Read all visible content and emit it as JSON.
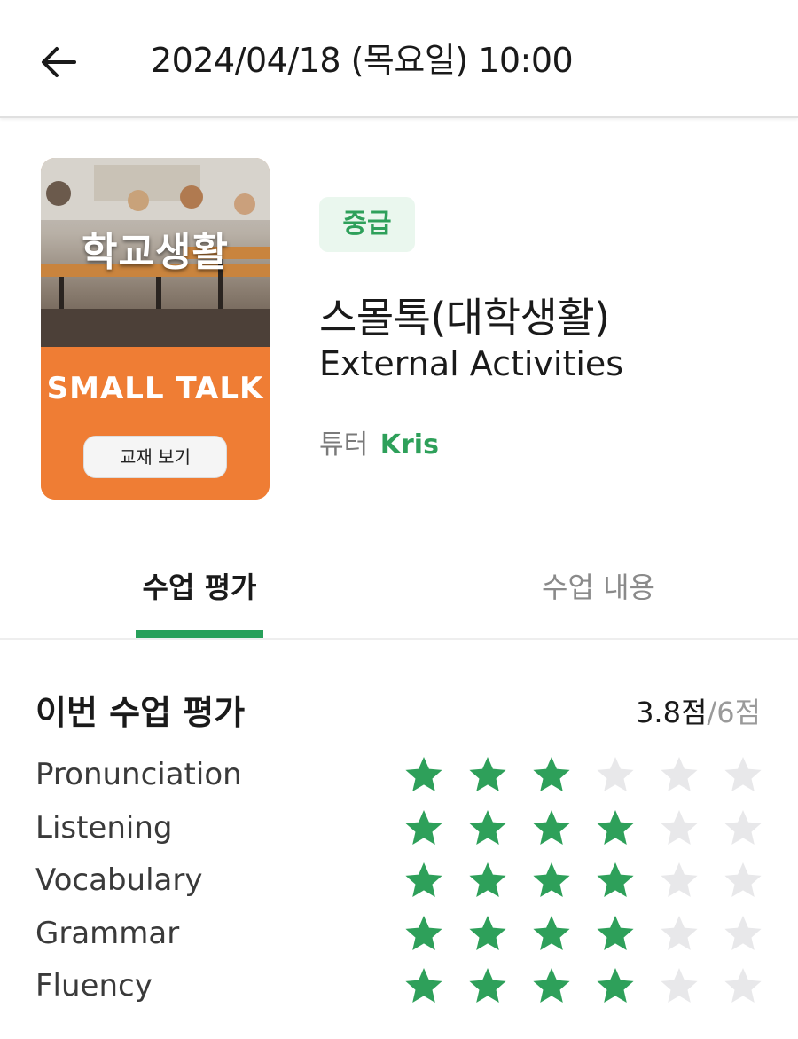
{
  "header": {
    "title": "2024/04/18 (목요일) 10:00",
    "back_icon": "arrow-left-icon"
  },
  "lesson": {
    "thumbnail": {
      "title": "학교생활",
      "subtitle": "SMALL TALK",
      "material_button": "교재 보기"
    },
    "level": "중급",
    "title_ko": "스몰톡(대학생활)",
    "title_en": "External Activities",
    "tutor_label": "튜터",
    "tutor_name": "Kris"
  },
  "tabs": [
    {
      "label": "수업 평가",
      "active": true
    },
    {
      "label": "수업 내용",
      "active": false
    }
  ],
  "rating": {
    "heading": "이번 수업 평가",
    "score": "3.8점",
    "max": "/6점",
    "max_stars": 6,
    "items": [
      {
        "label": "Pronunciation",
        "value": 3
      },
      {
        "label": "Listening",
        "value": 4
      },
      {
        "label": "Vocabulary",
        "value": 4
      },
      {
        "label": "Grammar",
        "value": 4
      },
      {
        "label": "Fluency",
        "value": 4
      }
    ]
  },
  "colors": {
    "accent": "#27a05a",
    "star_filled": "#2ea05a",
    "star_empty": "#e8e8ea",
    "thumbnail_orange": "#ef7d34"
  }
}
